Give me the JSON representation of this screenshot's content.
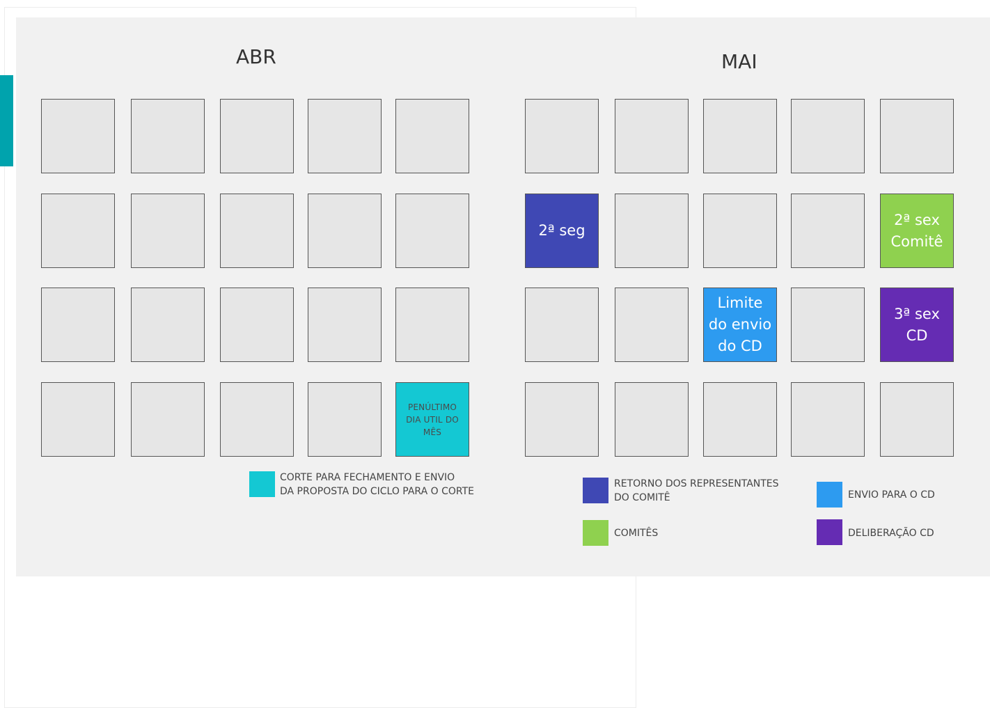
{
  "calendar": {
    "abr": {
      "title": "ABR",
      "special": {
        "r3c4": {
          "text": "PENÚLTIMO\nDIA UTIL DO\nMÊS",
          "color": "#14c8d3"
        }
      }
    },
    "mai": {
      "title": "MAI",
      "special": {
        "r1c0": {
          "text": "2ª seg",
          "color": "#3f48b4"
        },
        "r1c4": {
          "text": "2ª sex\nComitê",
          "color": "#8fd14f"
        },
        "r2c2": {
          "text": "Limite\ndo envio\ndo CD",
          "color": "#2d9bf0"
        },
        "r2c4": {
          "text": "3ª sex\nCD",
          "color": "#652cb3"
        }
      }
    }
  },
  "legend": {
    "corte": {
      "text": "CORTE PARA FECHAMENTO E ENVIO\nDA PROPOSTA DO CICLO PARA O CORTE",
      "color": "#14c8d3"
    },
    "retorno": {
      "text": "RETORNO DOS REPRESENTANTES\nDO COMITÊ",
      "color": "#3f48b4"
    },
    "envio": {
      "text": "ENVIO PARA O CD",
      "color": "#2d9bf0"
    },
    "comites": {
      "text": "COMITÊS",
      "color": "#8fd14f"
    },
    "deliberacao": {
      "text": "DELIBERAÇÃO CD",
      "color": "#652cb3"
    }
  }
}
